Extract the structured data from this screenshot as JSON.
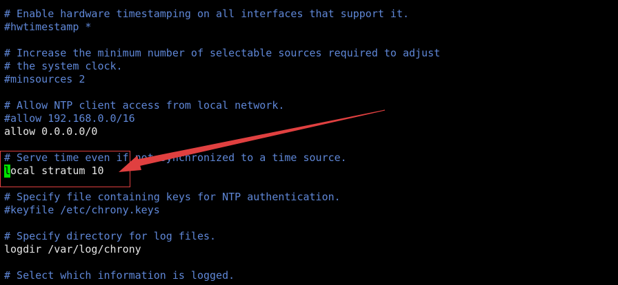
{
  "colors": {
    "background": "#000000",
    "comment": "#5f87d7",
    "text": "#e6e6e6",
    "cursor": "#00e000",
    "annotation": "#e04040"
  },
  "lines": {
    "l1": "# Enable hardware timestamping on all interfaces that support it.",
    "l2": "#hwtimestamp *",
    "l3": "# Increase the minimum number of selectable sources required to adjust",
    "l4": "# the system clock.",
    "l5": "#minsources 2",
    "l6": "# Allow NTP client access from local network.",
    "l7": "#allow 192.168.0.0/16",
    "l8": "allow 0.0.0.0/0",
    "l9": "# Serve time even if not synchronized to a time source.",
    "l10_cursor": "l",
    "l10_rest": "ocal stratum 10",
    "l11": "# Specify file containing keys for NTP authentication.",
    "l12": "#keyfile /etc/chrony.keys",
    "l13": "# Specify directory for log files.",
    "l14": "logdir /var/log/chrony",
    "l15": "# Select which information is logged."
  },
  "annotation": {
    "arrow_icon": "red-arrow-icon",
    "box": "red-highlight-box"
  }
}
